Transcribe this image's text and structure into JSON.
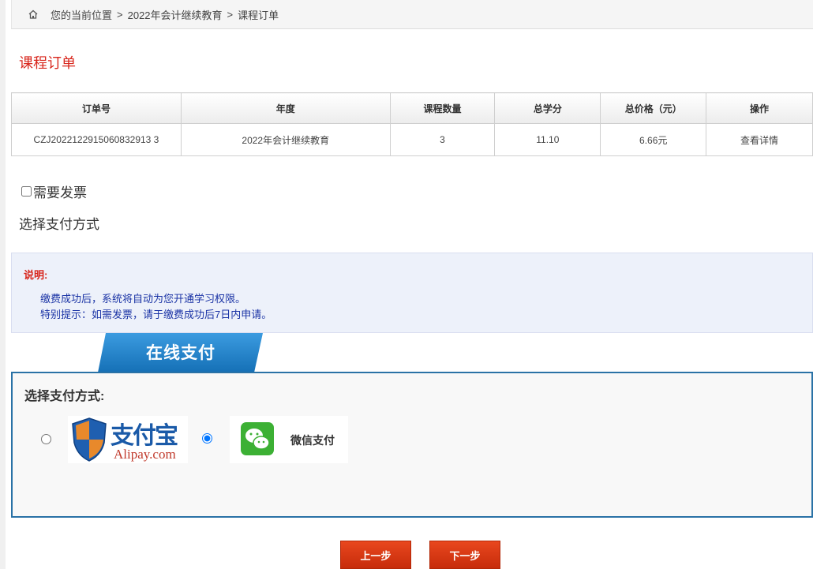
{
  "breadcrumb": {
    "prefix": "您的当前位置",
    "items": [
      "2022年会计继续教育",
      "课程订单"
    ],
    "separator": ">"
  },
  "page_title": "课程订单",
  "table": {
    "headers": [
      "订单号",
      "年度",
      "课程数量",
      "总学分",
      "总价格（元）",
      "操作"
    ],
    "rows": [
      [
        "CZJ2022122915060832913 3",
        "2022年会计继续教育",
        "3",
        "11.10",
        "6.66元",
        "查看详情"
      ]
    ]
  },
  "invoice": {
    "label": "需要发票",
    "checked": false
  },
  "payment_heading": "选择支付方式",
  "notice": {
    "title": "说明:",
    "lines": [
      "缴费成功后，系统将自动为您开通学习权限。",
      "特别提示：如需发票，请于缴费成功后7日内申请。"
    ]
  },
  "online_payment": {
    "tab_label": "在线支付",
    "box_title": "选择支付方式:",
    "options": [
      {
        "name": "支付宝",
        "sub": "Alipay.com",
        "selected": false
      },
      {
        "name": "微信支付",
        "selected": true
      }
    ]
  },
  "buttons": {
    "prev": "上一步",
    "next": "下一步"
  },
  "colors": {
    "accent_red": "#d8261c",
    "tab_blue": "#1f7fc4",
    "button_red": "#d93a14",
    "wechat_green": "#3cb034"
  }
}
